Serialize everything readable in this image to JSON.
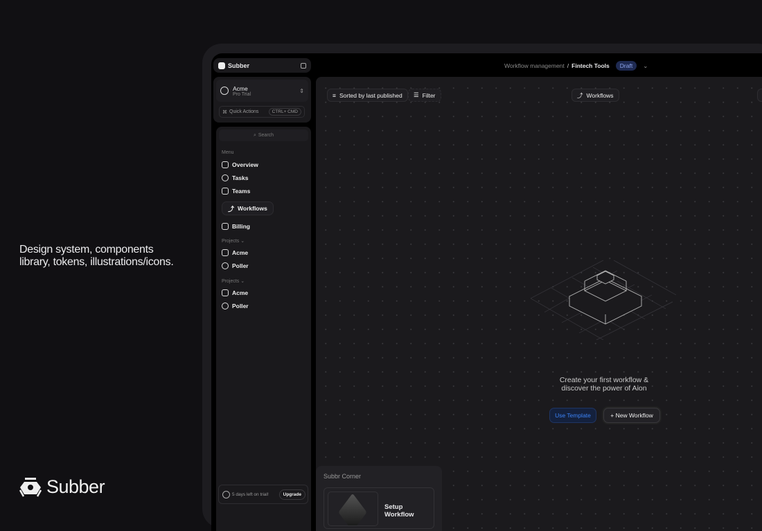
{
  "promo": {
    "tagline_line1": "Design system, components",
    "tagline_line2": "library, tokens, illustrations/icons.",
    "brand": "Subber"
  },
  "app": {
    "name": "Subber"
  },
  "workspace": {
    "name": "Acme",
    "plan": "Pro Trial"
  },
  "quick_actions": {
    "label": "Quick Actions",
    "shortcut": "CTRL+ CMD"
  },
  "search": {
    "placeholder": "Search"
  },
  "menu": {
    "heading": "Menu",
    "items": [
      {
        "label": "Overview"
      },
      {
        "label": "Tasks"
      },
      {
        "label": "Teams"
      },
      {
        "label": "Workflows"
      },
      {
        "label": "Billing"
      }
    ]
  },
  "projects": [
    {
      "heading": "Projects",
      "items": [
        {
          "label": "Acme"
        },
        {
          "label": "Poller"
        }
      ]
    },
    {
      "heading": "Projects",
      "items": [
        {
          "label": "Acme"
        },
        {
          "label": "Poller"
        }
      ]
    }
  ],
  "trial": {
    "text": "5 days left on trial!",
    "button": "Upgrade"
  },
  "breadcrumb": {
    "parent": "Workflow management",
    "separator": "/",
    "current": "Fintech Tools",
    "status": "Draft"
  },
  "toolbar": {
    "sort": "Sorted by last published",
    "filter": "Filter",
    "view": "Workflows"
  },
  "empty_state": {
    "line1": "Create your first workflow &",
    "line2": "discover the power of Aion",
    "use_template": "Use Template",
    "new_workflow": "+ New Workflow"
  },
  "corner": {
    "title": "Subbr Corner",
    "card_title": "Setup Workflow"
  },
  "colors": {
    "accent": "#3b82f6",
    "draft_bg": "#1e2a52"
  }
}
